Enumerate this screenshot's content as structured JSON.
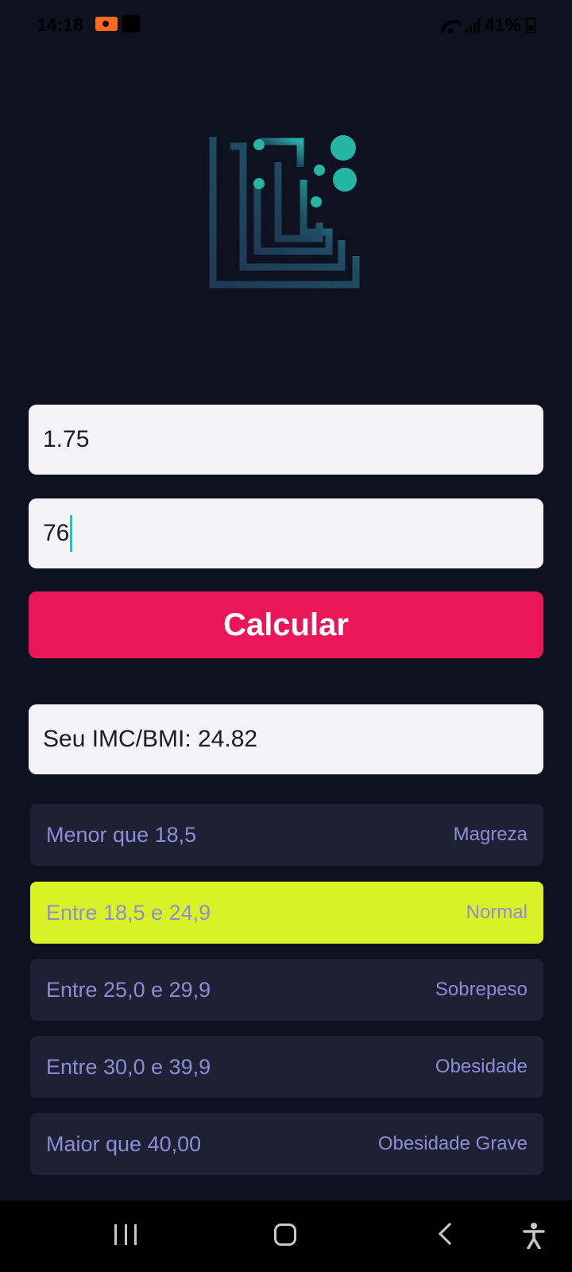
{
  "status_bar": {
    "time": "14:18",
    "battery": "41%",
    "icons": [
      "recording-icon",
      "media-icon",
      "wifi-icon",
      "signal-icon",
      "battery-icon"
    ]
  },
  "form": {
    "height_value": "1.75",
    "weight_value": "76",
    "calculate_label": "Calcular"
  },
  "result": {
    "text": "Seu IMC/BMI: 24.82"
  },
  "bmi_table": [
    {
      "range": "Menor que 18,5",
      "classification": "Magreza",
      "highlighted": false
    },
    {
      "range": "Entre 18,5 e 24,9",
      "classification": "Normal",
      "highlighted": true
    },
    {
      "range": "Entre 25,0 e 29,9",
      "classification": "Sobrepeso",
      "highlighted": false
    },
    {
      "range": "Entre 30,0 e 39,9",
      "classification": "Obesidade",
      "highlighted": false
    },
    {
      "range": "Maior que 40,00",
      "classification": "Obesidade Grave",
      "highlighted": false
    }
  ],
  "colors": {
    "background": "#0d1120",
    "accent_button": "#ea1758",
    "highlight_row": "#d9f225",
    "row_background": "#1e2033",
    "row_text": "#8b8ed6",
    "logo_teal": "#22b3a2",
    "logo_dark": "#1f3a55"
  },
  "nav_bar": {
    "icons": [
      "recent-apps-icon",
      "home-icon",
      "back-icon",
      "accessibility-icon"
    ]
  }
}
